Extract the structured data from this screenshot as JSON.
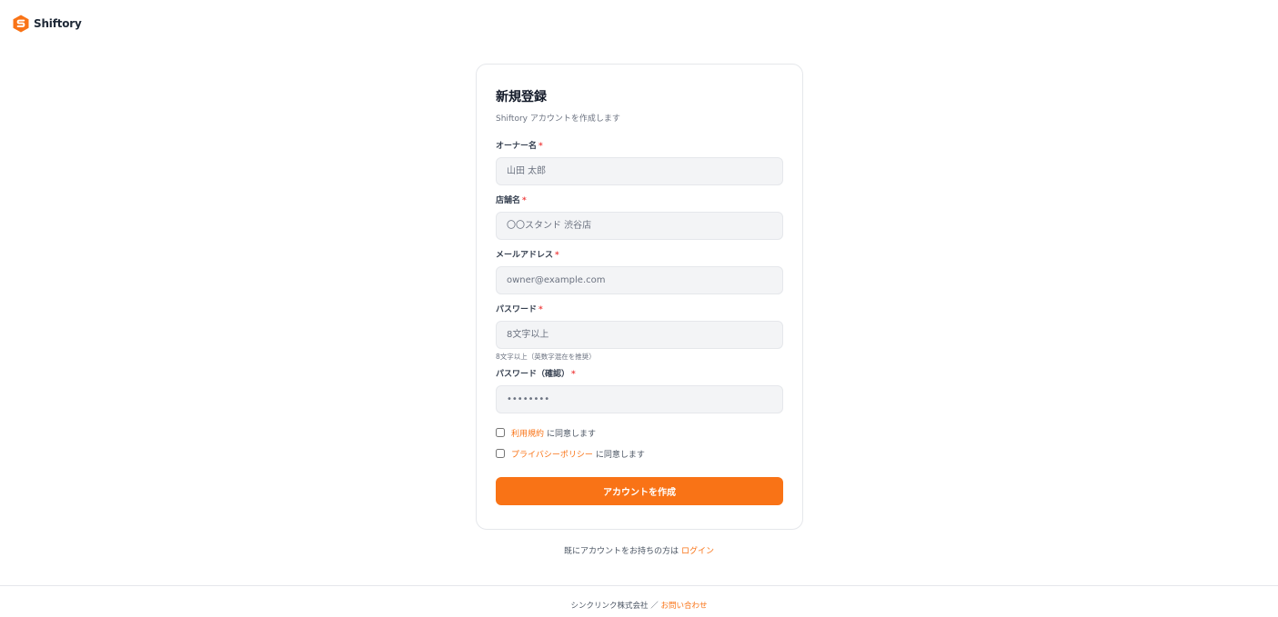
{
  "brand": {
    "name": "Shiftory",
    "color": "#f97316"
  },
  "form": {
    "title": "新規登録",
    "subtitle": "Shiftory アカウントを作成します",
    "required_mark": "*",
    "owner": {
      "label": "オーナー名",
      "placeholder": "山田 太郎",
      "value": ""
    },
    "store": {
      "label": "店舗名",
      "placeholder": "〇〇スタンド 渋谷店",
      "value": ""
    },
    "email": {
      "label": "メールアドレス",
      "placeholder": "owner@example.com",
      "value": ""
    },
    "password": {
      "label": "パスワード",
      "placeholder": "8文字以上",
      "value": "",
      "hint": "8文字以上（英数字混在を推奨）"
    },
    "password_confirm": {
      "label": "パスワード（確認）",
      "placeholder": "••••••••",
      "value": ""
    },
    "terms": {
      "link": "利用規約",
      "text": "に同意します",
      "checked": false
    },
    "privacy": {
      "link": "プライバシーポリシー",
      "text": "に同意します",
      "checked": false
    },
    "submit_label": "アカウントを作成"
  },
  "login": {
    "text": "既にアカウントをお持ちの方は",
    "link": "ログイン"
  },
  "footer": {
    "company": "シンクリンク株式会社",
    "separator": "／",
    "contact": "お問い合わせ"
  }
}
